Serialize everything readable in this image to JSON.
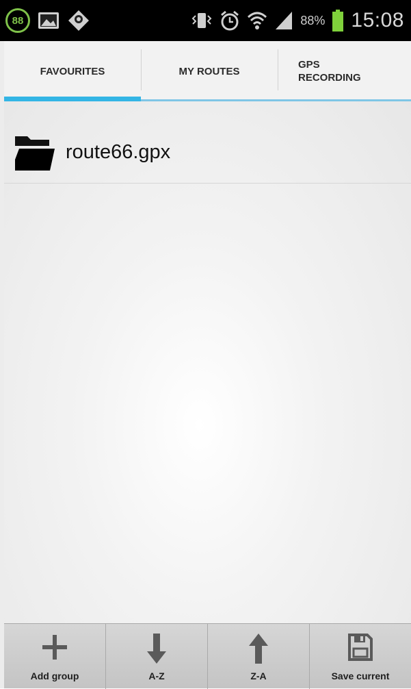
{
  "status_bar": {
    "badge": "88",
    "battery_percent": "88%",
    "time": "15:08",
    "icons": [
      "gallery-icon",
      "location-icon",
      "vibrate-icon",
      "alarm-icon",
      "wifi-icon",
      "signal-icon",
      "battery-icon"
    ],
    "battery_color": "#7fd13b"
  },
  "tabs": [
    {
      "label": "FAVOURITES",
      "selected": true
    },
    {
      "label": "MY ROUTES",
      "selected": false
    },
    {
      "label": "GPS\nRECORDING",
      "selected": false
    }
  ],
  "accent_color": "#33b5e5",
  "list": {
    "items": [
      {
        "label": "route66.gpx",
        "icon": "folder-icon"
      }
    ]
  },
  "actions": [
    {
      "label": "Add group",
      "icon": "plus-icon"
    },
    {
      "label": "A-Z",
      "icon": "arrow-down-icon"
    },
    {
      "label": "Z-A",
      "icon": "arrow-up-icon"
    },
    {
      "label": "Save current",
      "icon": "save-icon"
    }
  ]
}
